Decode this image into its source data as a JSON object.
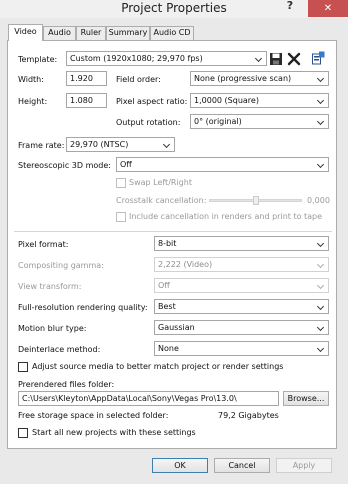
{
  "window": {
    "title": "Project Properties",
    "help": "?",
    "close": "✕"
  },
  "tabs": [
    {
      "label": "Video"
    },
    {
      "label": "Audio"
    },
    {
      "label": "Ruler"
    },
    {
      "label": "Summary"
    },
    {
      "label": "Audio CD"
    }
  ],
  "video": {
    "template_label": "Template:",
    "template_value": "Custom (1920x1080; 29,970 fps)",
    "width_label": "Width:",
    "width_value": "1.920",
    "height_label": "Height:",
    "height_value": "1.080",
    "field_order_label": "Field order:",
    "field_order_value": "None (progressive scan)",
    "pixel_aspect_label": "Pixel aspect ratio:",
    "pixel_aspect_value": "1,0000 (Square)",
    "output_rotation_label": "Output rotation:",
    "output_rotation_value": "0° (original)",
    "frame_rate_label": "Frame rate:",
    "frame_rate_value": "29,970 (NTSC)",
    "stereo_label": "Stereoscopic 3D mode:",
    "stereo_value": "Off",
    "swap_lr_label": "Swap Left/Right",
    "crosstalk_label": "Crosstalk cancellation:",
    "crosstalk_value": "0,000",
    "include_cancellation_label": "Include cancellation in renders and print to tape",
    "pixel_format_label": "Pixel format:",
    "pixel_format_value": "8-bit",
    "compositing_gamma_label": "Compositing gamma:",
    "compositing_gamma_value": "2,222 (Video)",
    "view_transform_label": "View transform:",
    "view_transform_value": "Off",
    "full_res_label": "Full-resolution rendering quality:",
    "full_res_value": "Best",
    "motion_blur_label": "Motion blur type:",
    "motion_blur_value": "Gaussian",
    "deinterlace_label": "Deinterlace method:",
    "deinterlace_value": "None",
    "adjust_media_label": "Adjust source media to better match project or render settings",
    "prerendered_label": "Prerendered files folder:",
    "prerendered_value": "C:\\Users\\Kleyton\\AppData\\Local\\Sony\\Vegas Pro\\13.0\\",
    "browse_label": "Browse...",
    "free_storage_label": "Free storage space in selected folder:",
    "free_storage_value": "79,2 Gigabytes",
    "start_all_label": "Start all new projects with these settings"
  },
  "buttons": {
    "ok": "OK",
    "cancel": "Cancel",
    "apply": "Apply"
  },
  "icons": {
    "save": "save-icon",
    "delete": "delete-icon",
    "match_media": "match-media-icon"
  }
}
